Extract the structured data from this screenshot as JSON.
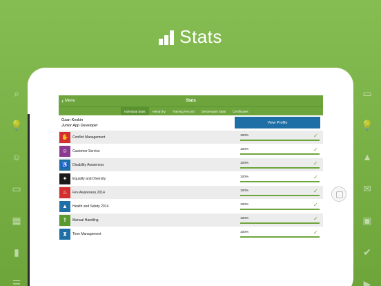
{
  "hero": {
    "title": "Stats"
  },
  "left_icons": [
    "search-icon",
    "lightbulb-icon",
    "smiley-icon",
    "chat-icon",
    "calendar-icon",
    "stats-icon",
    "list-icon"
  ],
  "right_icons": [
    "window-icon",
    "lightbulb-icon",
    "warning-icon",
    "envelope-icon",
    "gallery-icon",
    "check-icon",
    "play-icon"
  ],
  "app": {
    "nav": {
      "back_label": "Menu",
      "title": "Stats"
    },
    "tabs": [
      "Individual Stats",
      "Hierarchy",
      "Training Record",
      "Descendant Stats",
      "Certificates"
    ],
    "active_tab": "Individual Stats",
    "user": {
      "name": "Ozan  Keskin",
      "role": "Junior App Developer"
    },
    "view_profile": "View Profile",
    "courses": [
      {
        "name": "Conflict Management",
        "progress": "100%",
        "value": 1.0,
        "color": "#d42f2f",
        "icon": "hand-stop-icon"
      },
      {
        "name": "Customer Service",
        "progress": "100%",
        "value": 1.0,
        "color": "#8b3a8f",
        "icon": "customer-icon"
      },
      {
        "name": "Disability Awareness",
        "progress": "100%",
        "value": 1.0,
        "color": "#1e6fa6",
        "icon": "wheelchair-icon"
      },
      {
        "name": "Equality and Diversity",
        "progress": "100%",
        "value": 1.0,
        "color": "#1a1a1a",
        "icon": "handshake-icon"
      },
      {
        "name": "Fire Awareness 2014",
        "progress": "100%",
        "value": 1.0,
        "color": "#d42f2f",
        "icon": "fire-icon"
      },
      {
        "name": "Health and Safety 2014",
        "progress": "100%",
        "value": 1.0,
        "color": "#1e6fa6",
        "icon": "warning-icon"
      },
      {
        "name": "Manual Handling",
        "progress": "100%",
        "value": 1.0,
        "color": "#5a9a2f",
        "icon": "lifting-icon"
      },
      {
        "name": "Time Management",
        "progress": "100%",
        "value": 1.0,
        "color": "#1e6fa6",
        "icon": "hourglass-icon"
      }
    ]
  }
}
